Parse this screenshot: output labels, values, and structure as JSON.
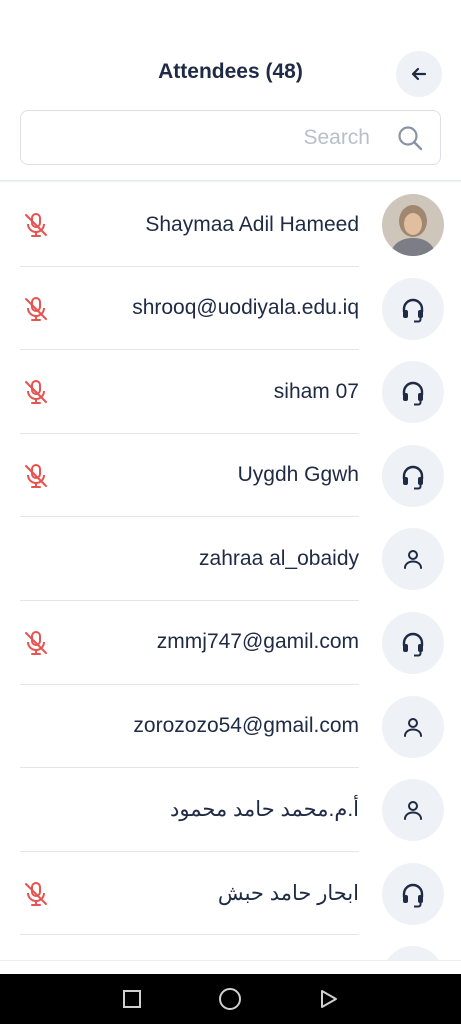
{
  "header": {
    "title": "Attendees (48)",
    "back_icon": "arrow-left-icon"
  },
  "search": {
    "placeholder": "Search",
    "value": "",
    "icon": "search-icon"
  },
  "attendees": [
    {
      "name": "Shaymaa Adil Hameed",
      "avatar": "photo",
      "muted": true
    },
    {
      "name": "shrooq@uodiyala.edu.iq",
      "avatar": "headphones-icon",
      "muted": true
    },
    {
      "name": "siham 07",
      "avatar": "headphones-icon",
      "muted": true
    },
    {
      "name": "Uygdh Ggwh",
      "avatar": "headphones-icon",
      "muted": true
    },
    {
      "name": "zahraa al_obaidy",
      "avatar": "user-icon",
      "muted": false
    },
    {
      "name": "zmmj747@gamil.com",
      "avatar": "headphones-icon",
      "muted": true
    },
    {
      "name": "zorozozo54@gmail.com",
      "avatar": "user-icon",
      "muted": false
    },
    {
      "name": "أ.م.محمد حامد محمود",
      "avatar": "user-icon",
      "muted": false
    },
    {
      "name": "ابحار حامد حبش",
      "avatar": "headphones-icon",
      "muted": true
    }
  ],
  "colors": {
    "title": "#1f2a44",
    "muted_mic": "#e8524f",
    "avatar_bg": "#eef1f6",
    "status_dot": "#2ecc71"
  },
  "navbar": {
    "recents_icon": "square-icon",
    "home_icon": "circle-icon",
    "back_icon": "triangle-back-icon"
  }
}
